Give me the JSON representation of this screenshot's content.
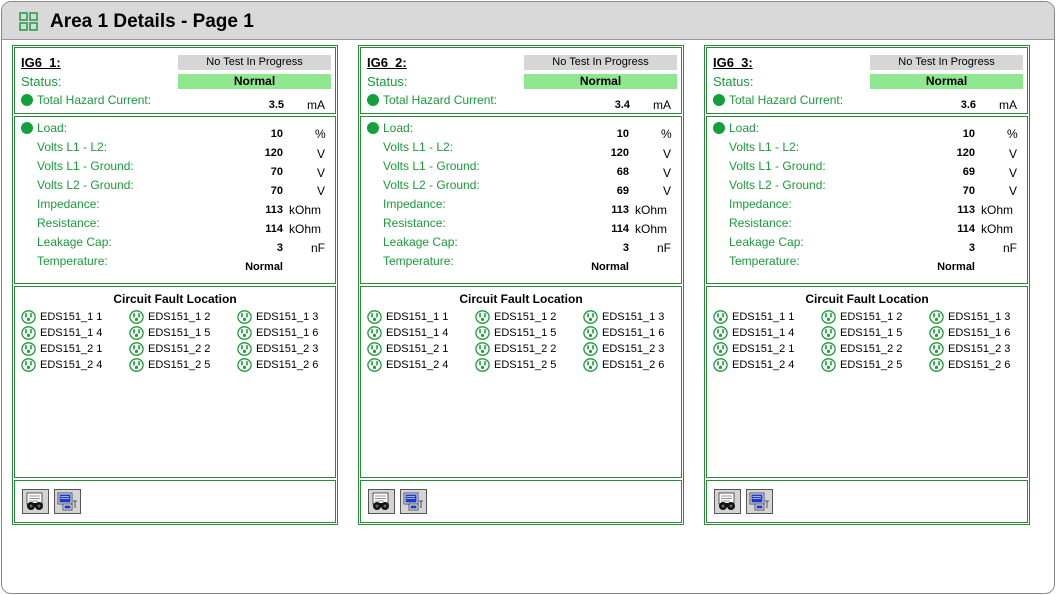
{
  "window": {
    "title": "Area 1 Details - Page 1"
  },
  "labels": {
    "status": "Status:",
    "total_hazard_current": "Total Hazard Current:",
    "load": "Load:",
    "volts_l1_l2": "Volts L1 - L2:",
    "volts_l1_ground": "Volts L1 - Ground:",
    "volts_l2_ground": "Volts L2 - Ground:",
    "impedance": "Impedance:",
    "resistance": "Resistance:",
    "leakage_cap": "Leakage Cap:",
    "temperature": "Temperature:",
    "circuit_fault_location": "Circuit Fault Location"
  },
  "units": {
    "current": "mA",
    "load": "%",
    "volts": "V",
    "ohm": "kOhm",
    "cap": "nF"
  },
  "panels": [
    {
      "name": "IG6_1:",
      "test_status": "No Test In Progress",
      "status": "Normal",
      "total_hazard_current": "3.5",
      "load": "10",
      "volts_l1_l2": "120",
      "volts_l1_ground": "70",
      "volts_l2_ground": "70",
      "impedance": "113",
      "resistance": "114",
      "leakage_cap": "3",
      "temperature": "Normal",
      "circuits": [
        "EDS151_1 1",
        "EDS151_1 2",
        "EDS151_1 3",
        "EDS151_1 4",
        "EDS151_1 5",
        "EDS151_1 6",
        "EDS151_2 1",
        "EDS151_2 2",
        "EDS151_2 3",
        "EDS151_2 4",
        "EDS151_2 5",
        "EDS151_2 6"
      ]
    },
    {
      "name": "IG6_2:",
      "test_status": "No Test In Progress",
      "status": "Normal",
      "total_hazard_current": "3.4",
      "load": "10",
      "volts_l1_l2": "120",
      "volts_l1_ground": "68",
      "volts_l2_ground": "69",
      "impedance": "113",
      "resistance": "114",
      "leakage_cap": "3",
      "temperature": "Normal",
      "circuits": [
        "EDS151_1 1",
        "EDS151_1 2",
        "EDS151_1 3",
        "EDS151_1 4",
        "EDS151_1 5",
        "EDS151_1 6",
        "EDS151_2 1",
        "EDS151_2 2",
        "EDS151_2 3",
        "EDS151_2 4",
        "EDS151_2 5",
        "EDS151_2 6"
      ]
    },
    {
      "name": "IG6_3:",
      "test_status": "No Test In Progress",
      "status": "Normal",
      "total_hazard_current": "3.6",
      "load": "10",
      "volts_l1_l2": "120",
      "volts_l1_ground": "69",
      "volts_l2_ground": "70",
      "impedance": "113",
      "resistance": "114",
      "leakage_cap": "3",
      "temperature": "Normal",
      "circuits": [
        "EDS151_1 1",
        "EDS151_1 2",
        "EDS151_1 3",
        "EDS151_1 4",
        "EDS151_1 5",
        "EDS151_1 6",
        "EDS151_2 1",
        "EDS151_2 2",
        "EDS151_2 3",
        "EDS151_2 4",
        "EDS151_2 5",
        "EDS151_2 6"
      ]
    }
  ],
  "icons": {
    "title": "grid-icon",
    "status_indicator": "green-dot-icon",
    "circuit": "outlet-icon",
    "button_1": "binoculars-icon",
    "button_2": "computer-icon"
  },
  "colors": {
    "accent_green": "#1a9a3a",
    "panel_border": "#2a8a3a",
    "status_normal_bg": "#8fe88f",
    "test_box_bg": "#d6d6d6",
    "titlebar_bg": "#d9d9d9"
  }
}
